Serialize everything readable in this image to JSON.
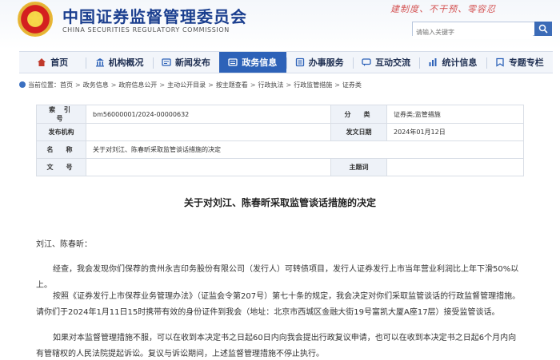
{
  "header": {
    "site_name_cn": "中国证券监督管理委员会",
    "site_name_en": "CHINA SECURITIES REGULATORY COMMISSION",
    "slogan": "建制度、不干预、零容忍",
    "search_placeholder": "请输入关键字"
  },
  "nav": {
    "items": [
      {
        "label": "首页",
        "icon": "home-icon"
      },
      {
        "label": "机构概况",
        "icon": "institution-icon"
      },
      {
        "label": "新闻发布",
        "icon": "news-icon"
      },
      {
        "label": "政务信息",
        "icon": "gov-info-icon"
      },
      {
        "label": "办事服务",
        "icon": "service-icon"
      },
      {
        "label": "互动交流",
        "icon": "interaction-icon"
      },
      {
        "label": "统计信息",
        "icon": "statistics-icon"
      },
      {
        "label": "专题专栏",
        "icon": "topics-icon"
      }
    ],
    "active_index": 3
  },
  "breadcrumb": {
    "prefix": "当前位置：",
    "items": [
      "首页",
      "政务信息",
      "政府信息公开",
      "主动公开目录",
      "按主题查看",
      "行政执法",
      "行政监管措施",
      "证券类"
    ]
  },
  "info_table": {
    "index_label": "索 引 号",
    "index_value": "bm56000001/2024-00000632",
    "category_label": "分　类",
    "category_value": "证券类;监管措施",
    "issuer_label": "发布机构",
    "issuer_value": "",
    "date_label": "发文日期",
    "date_value": "2024年01月12日",
    "name_label": "名　称",
    "name_value": "关于对刘江、陈春昕采取监管谈话措施的决定",
    "docno_label": "文　号",
    "docno_value": "",
    "subject_label": "主题词",
    "subject_value": ""
  },
  "article": {
    "title": "关于对刘江、陈春昕采取监管谈话措施的决定",
    "salutation": "刘江、陈春昕：",
    "paragraphs": [
      "经查，我会发现你们保荐的贵州永吉印务股份有限公司（发行人）可转债项目，发行人证券发行上市当年营业利润比上年下滑50%以上。",
      "按照《证券发行上市保荐业务管理办法》（证监会令第207号）第七十条的规定，我会决定对你们采取监管谈话的行政监督管理措施。请你们于2024年1月11日15时携带有效的身份证件到我会（地址：北京市西城区金融大街19号富凯大厦A座17层）接受监管谈话。",
      "如果对本监督管理措施不服，可以在收到本决定书之日起60日内向我会提出行政复议申请，也可以在收到本决定书之日起6个月内向有管辖权的人民法院提起诉讼。复议与诉讼期间，上述监督管理措施不停止执行。"
    ]
  },
  "colors": {
    "brand_blue": "#1b3f8f",
    "nav_active": "#2d62b8",
    "slogan_red": "#d45353"
  }
}
